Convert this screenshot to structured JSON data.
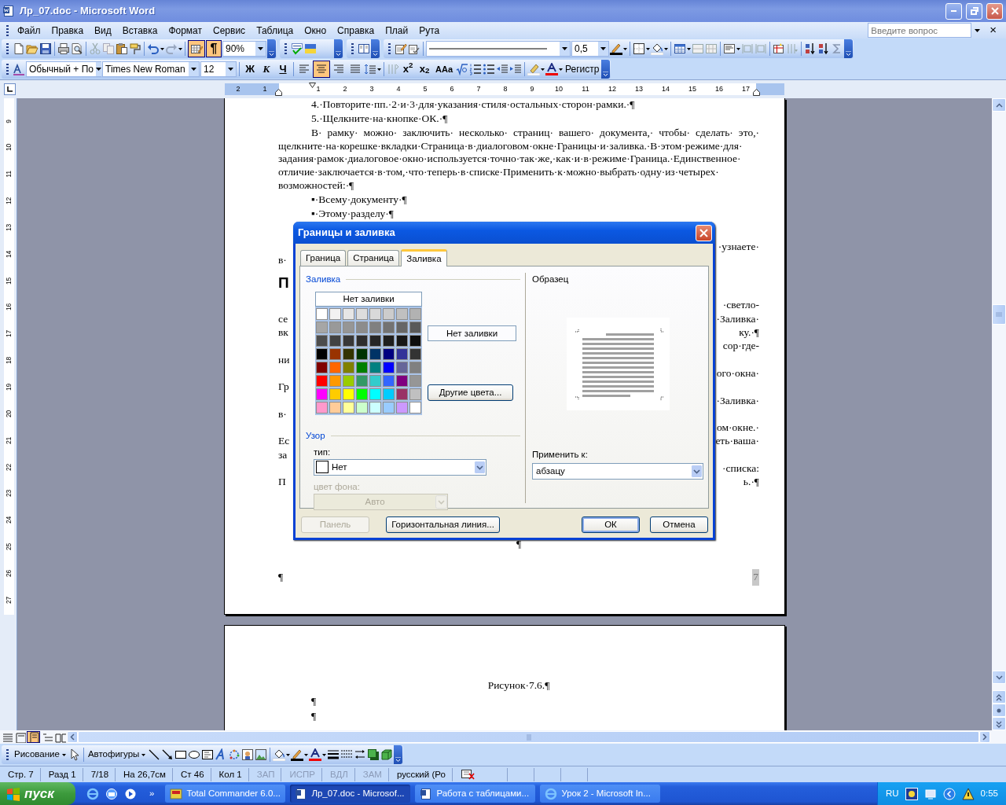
{
  "window": {
    "title": "Лр_07.doc - Microsoft Word"
  },
  "menu": [
    "Файл",
    "Правка",
    "Вид",
    "Вставка",
    "Формат",
    "Сервис",
    "Таблица",
    "Окно",
    "Справка",
    "Плай",
    "Рута"
  ],
  "help_box": {
    "placeholder": "Введите вопрос",
    "close": "×"
  },
  "standard_toolbar": {
    "tables_toggle_pressed": true,
    "pilcrow": {
      "text": "¶",
      "pressed": true
    },
    "zoom": "90%",
    "line_weight": "0,5"
  },
  "formatting_toolbar": {
    "style": "Обычный + По",
    "font": "Times New Roman",
    "size": "12",
    "bold": "Ж",
    "italic": "К",
    "underline": "Ч",
    "alignment": [
      {
        "selected": false
      },
      {
        "selected": true
      },
      {
        "selected": false
      },
      {
        "selected": false
      }
    ],
    "superscript": "x$^{2}$",
    "subscript": "x$_{2}$",
    "case": "AAa",
    "change_case": "Регистр"
  },
  "ruler": [
    "2",
    "1",
    "1",
    "2",
    "3",
    "4",
    "5",
    "6",
    "7",
    "8",
    "9",
    "10",
    "11",
    "12",
    "13",
    "14",
    "15",
    "16",
    "17"
  ],
  "vertical_ruler": [
    "9",
    "10",
    "11",
    "12",
    "13",
    "14",
    "15",
    "16",
    "17",
    "18",
    "19",
    "20",
    "21",
    "22",
    "23",
    "24",
    "25",
    "26",
    "27"
  ],
  "page": {
    "lines": [
      {
        "kind": "list_item",
        "text": "4.·Повторите·пп.·2·и·3·для·указания·стиля·остальных·сторон·рамки.·¶"
      },
      {
        "kind": "list_item",
        "text": "5.·Щелкните·на·кнопке·ОК.·¶"
      },
      {
        "kind": "paragraph",
        "text": "В· рамку· можно· заключить· несколько· страниц· вашего· документа,· чтобы· сделать· это,· щелкните·на·корешке·вкладки·Страница·в·диалоговом·окне·Границы·и·заливка.·В·этом·режиме·для· задания·рамок·диалоговое·окно·используется·точно·так·же,·как·и·в·режиме·Граница.·Единственное· отличие·заключается·в·том,·что·теперь·в·списке·Применить·к·можно·выбрать·одну·из·четырех· возможностей:·¶"
      },
      {
        "kind": "list_item",
        "text": "▪·Всему·документу·¶"
      },
      {
        "kind": "list_item",
        "text": "▪·Этому·разделу·¶"
      }
    ],
    "covered_rows": [
      {
        "right": "·узнаете·"
      },
      {
        "left": "в·"
      },
      {
        "kind": "heading",
        "left": "П"
      },
      {
        "right": "·светло-"
      },
      {
        "left": "се",
        "right": "·Заливка·"
      },
      {
        "left": "вк",
        "right": "ку.·¶"
      },
      {
        "right": "сор·где-"
      },
      {
        "left": "ни"
      },
      {
        "right": "ого·окна·"
      },
      {
        "left": "Гр"
      },
      {
        "right": "·Заливка·"
      },
      {
        "left": "в·"
      },
      {
        "right": "ом·окне.·"
      },
      {
        "left": "Ес",
        "right": "еть·ваша·"
      },
      {
        "left": "за"
      },
      {
        "right": "·списка:"
      },
      {
        "left": "П",
        "right": "ь.·¶"
      }
    ],
    "center_mark": "¶",
    "footer": {
      "mark": "¶",
      "page_number": "7"
    }
  },
  "next_page": {
    "caption": "Рисунок·7.6.¶",
    "marks": [
      "¶",
      "¶"
    ]
  },
  "dialog": {
    "title": "Границы и заливка",
    "tabs": [
      {
        "label": "Граница",
        "selected": false
      },
      {
        "label": "Страница",
        "selected": false
      },
      {
        "label": "Заливка",
        "selected": true
      }
    ],
    "fill": {
      "heading": "Заливка",
      "no_fill_button": "Нет заливки",
      "current": "Нет заливки",
      "more_colors_button": "Другие цвета...",
      "swatch_rows": [
        [
          {
            "color": "#ffffff"
          },
          {
            "color": "#f2f2f2"
          },
          {
            "color": "#e6e6e6"
          },
          {
            "color": "#dddddd"
          },
          {
            "color": "#d9d9d9"
          },
          {
            "color": "#cccccc"
          },
          {
            "color": "#c0c0c0"
          },
          {
            "color": "#b2b2b2"
          }
        ],
        [
          {
            "color": "#a6a6a6"
          },
          {
            "color": "#999999"
          },
          {
            "color": "#969696"
          },
          {
            "color": "#8c8c8c"
          },
          {
            "color": "#808080"
          },
          {
            "color": "#737373"
          },
          {
            "color": "#666666"
          },
          {
            "color": "#595959"
          }
        ],
        [
          {
            "color": "#4d4d4d"
          },
          {
            "color": "#424242"
          },
          {
            "color": "#383838"
          },
          {
            "color": "#2e2e2e"
          },
          {
            "color": "#262626"
          },
          {
            "color": "#1f1f1f"
          },
          {
            "color": "#171717"
          },
          {
            "color": "#0d0d0d"
          }
        ],
        [
          {
            "color": "#000000"
          },
          {
            "color": "#993300"
          },
          {
            "color": "#333300"
          },
          {
            "color": "#003300"
          },
          {
            "color": "#003366"
          },
          {
            "color": "#000080"
          },
          {
            "color": "#333399"
          },
          {
            "color": "#333333"
          }
        ],
        [
          {
            "color": "#800000"
          },
          {
            "color": "#ff6600"
          },
          {
            "color": "#808000"
          },
          {
            "color": "#008000"
          },
          {
            "color": "#008080"
          },
          {
            "color": "#0000ff"
          },
          {
            "color": "#666699"
          },
          {
            "color": "#808080"
          }
        ],
        [
          {
            "color": "#ff0000"
          },
          {
            "color": "#ff9900"
          },
          {
            "color": "#99cc00"
          },
          {
            "color": "#339966"
          },
          {
            "color": "#33cccc"
          },
          {
            "color": "#3366ff"
          },
          {
            "color": "#800080"
          },
          {
            "color": "#969696"
          }
        ],
        [
          {
            "color": "#ff00ff"
          },
          {
            "color": "#ffcc00"
          },
          {
            "color": "#ffff00"
          },
          {
            "color": "#00ff00"
          },
          {
            "color": "#00ffff"
          },
          {
            "color": "#00ccff"
          },
          {
            "color": "#993366"
          },
          {
            "color": "#c0c0c0"
          }
        ],
        [
          {
            "color": "#ff99cc"
          },
          {
            "color": "#ffcc99"
          },
          {
            "color": "#ffff99"
          },
          {
            "color": "#ccffcc"
          },
          {
            "color": "#ccffff"
          },
          {
            "color": "#99ccff"
          },
          {
            "color": "#cc99ff"
          },
          {
            "color": "#ffffff"
          }
        ]
      ]
    },
    "pattern": {
      "heading": "Узор",
      "type_label": "тип:",
      "type_value": "Нет",
      "background_label": "цвет фона:",
      "background_value": "Авто",
      "background_disabled": true
    },
    "preview": {
      "heading": "Образец"
    },
    "apply_to": {
      "label": "Применить к:",
      "value": "абзацу"
    },
    "buttons": [
      {
        "label": "Панель",
        "disabled": true,
        "default": false
      },
      {
        "label": "Горизонтальная линия...",
        "disabled": false,
        "default": false
      },
      {
        "label": "ОК",
        "disabled": false,
        "default": true
      },
      {
        "label": "Отмена",
        "disabled": false,
        "default": false
      }
    ]
  },
  "drawing_toolbar": {
    "draw_menu": "Рисование",
    "autoshapes": "Автофигуры"
  },
  "status_bar": [
    {
      "text": "Стр. 7",
      "disabled": false
    },
    {
      "text": "Разд 1",
      "disabled": false
    },
    {
      "text": "7/18",
      "disabled": false
    },
    {
      "text": "На 26,7см",
      "disabled": false
    },
    {
      "text": "Ст 46",
      "disabled": false
    },
    {
      "text": "Кол 1",
      "disabled": false
    },
    {
      "text": "ЗАП",
      "disabled": true
    },
    {
      "text": "ИСПР",
      "disabled": true
    },
    {
      "text": "ВДЛ",
      "disabled": true
    },
    {
      "text": "ЗАМ",
      "disabled": true
    },
    {
      "text": "русский (Ро",
      "disabled": false
    }
  ],
  "taskbar": {
    "start": "пуск",
    "more": "»",
    "tasks": [
      {
        "label": "Total Commander 6.0...",
        "selected": false
      },
      {
        "label": "Лр_07.doc - Microsof...",
        "selected": true
      },
      {
        "label": "Работа с таблицами...",
        "selected": false
      },
      {
        "label": "Урок 2 - Microsoft In...",
        "selected": false
      }
    ],
    "language": "RU",
    "clock": "0:55"
  }
}
